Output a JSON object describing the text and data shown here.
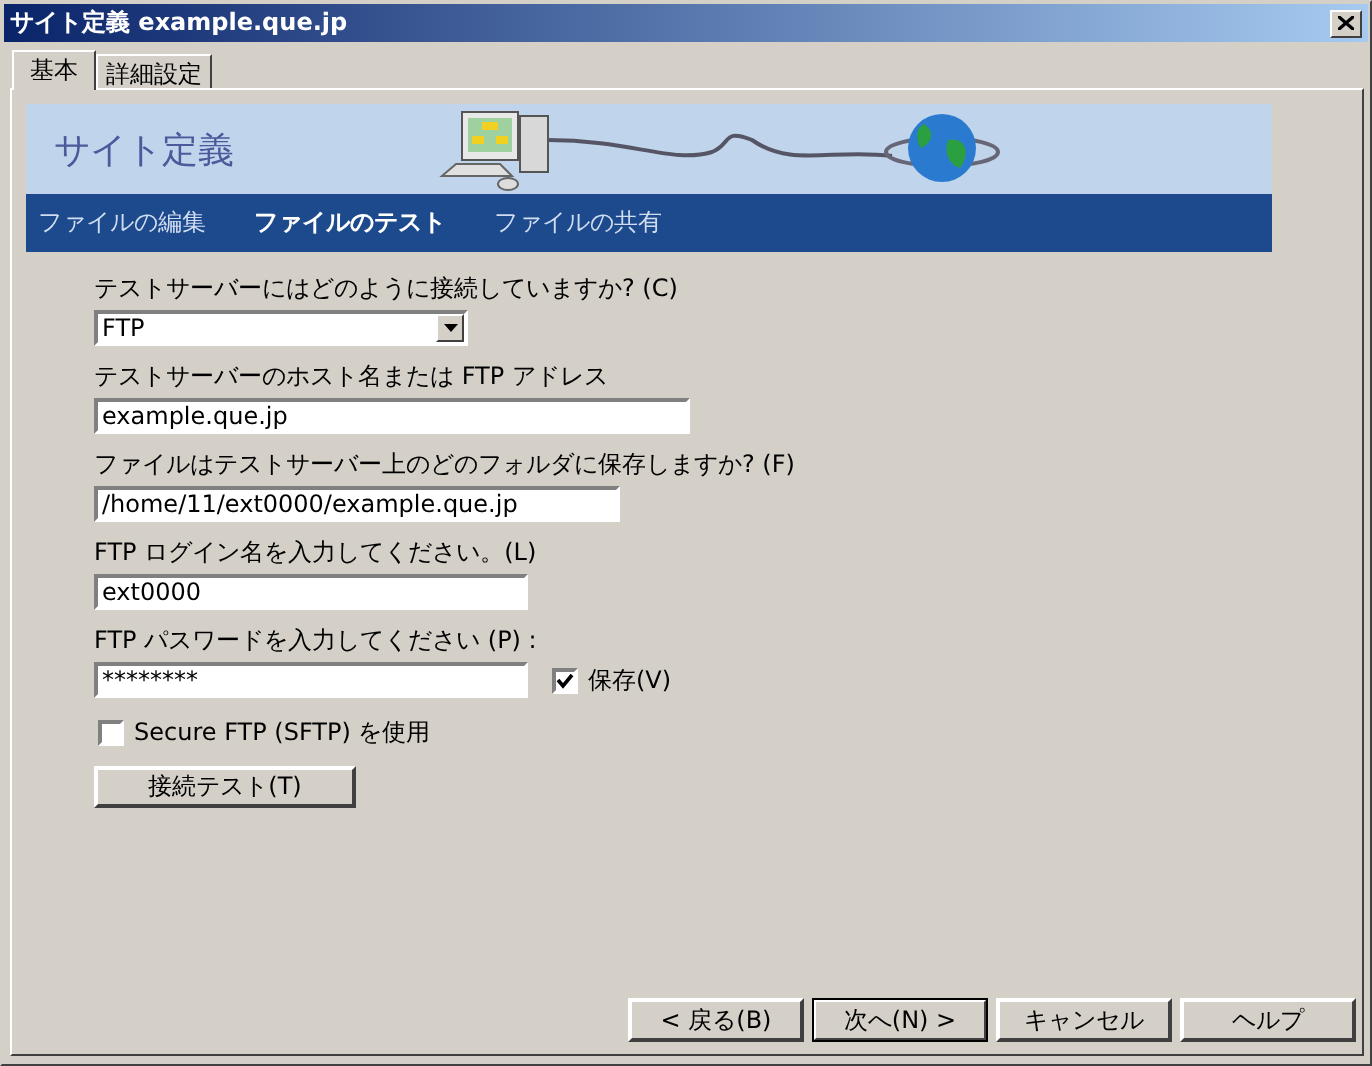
{
  "window": {
    "title": "サイト定義 example.que.jp"
  },
  "tabs": [
    {
      "label": "基本",
      "selected": true
    },
    {
      "label": "詳細設定",
      "selected": false
    }
  ],
  "banner": {
    "title": "サイト定義"
  },
  "steps": [
    {
      "label": "ファイルの編集",
      "selected": false
    },
    {
      "label": "ファイルのテスト",
      "selected": true
    },
    {
      "label": "ファイルの共有",
      "selected": false
    }
  ],
  "fields": [
    {
      "kind": "select",
      "label": "テストサーバーにはどのように接続していますか? (C)",
      "value": "FTP"
    },
    {
      "kind": "text",
      "label": "テストサーバーのホスト名または FTP アドレス",
      "value": "example.que.jp"
    },
    {
      "kind": "text",
      "label": "ファイルはテストサーバー上のどのフォルダに保存しますか? (F)",
      "value": "/home/11/ext0000/example.que.jp"
    },
    {
      "kind": "text",
      "label": "FTP ログイン名を入力してください。(L)",
      "value": "ext0000"
    },
    {
      "kind": "password",
      "label": "FTP パスワードを入力してください (P) :",
      "value": "********",
      "save": {
        "label": "保存(V)",
        "checked": true
      }
    }
  ],
  "sftp": {
    "label": "Secure FTP (SFTP) を使用",
    "checked": false
  },
  "test_button": "接続テスト(T)",
  "buttons": [
    {
      "label": "< 戻る(B)",
      "default": false
    },
    {
      "label": "次へ(N) >",
      "default": true
    },
    {
      "label": "キャンセル",
      "default": false
    },
    {
      "label": "ヘルプ",
      "default": false
    }
  ]
}
